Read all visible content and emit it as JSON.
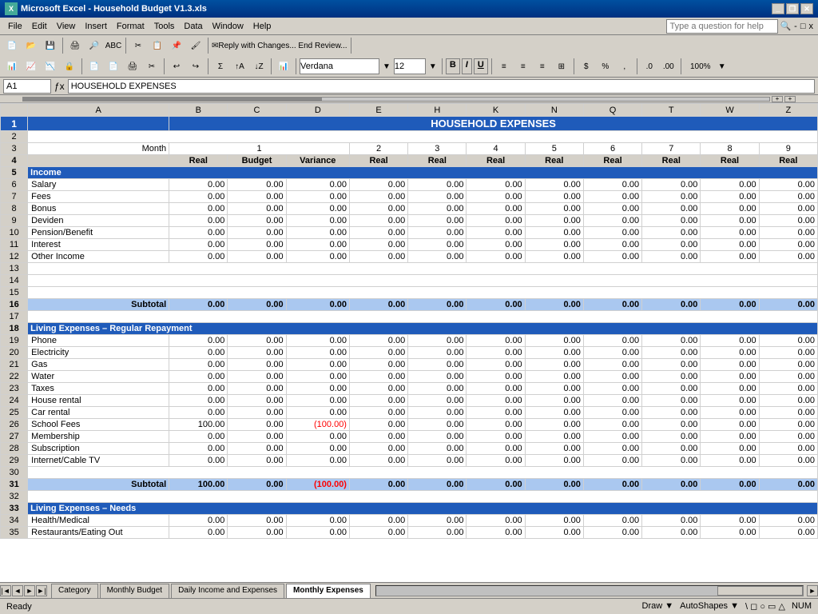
{
  "window": {
    "title": "Microsoft Excel - Household Budget V1.3.xls",
    "icon": "📊"
  },
  "menubar": {
    "items": [
      "File",
      "Edit",
      "View",
      "Insert",
      "Format",
      "Tools",
      "Data",
      "Window",
      "Help"
    ]
  },
  "toolbar": {
    "font": "Verdana",
    "font_size": "12",
    "zoom": "100%",
    "question_placeholder": "Type a question for help"
  },
  "formula_bar": {
    "cell_ref": "A1",
    "formula": "HOUSEHOLD EXPENSES"
  },
  "spreadsheet": {
    "title": "HOUSEHOLD EXPENSES",
    "col_headers": [
      "A",
      "B",
      "C",
      "D",
      "E",
      "H",
      "K",
      "N",
      "Q",
      "T",
      "W",
      "Z"
    ],
    "row_numbers": [
      1,
      2,
      3,
      4,
      5,
      6,
      7,
      8,
      9,
      10,
      11,
      12,
      13,
      14,
      15,
      16,
      17,
      18,
      19,
      20,
      21,
      22,
      23,
      24,
      25,
      26,
      27,
      28,
      29,
      30,
      31,
      32,
      33,
      34,
      35
    ],
    "months": [
      "",
      "1",
      "",
      "",
      "2",
      "3",
      "4",
      "5",
      "6",
      "7",
      "8",
      "9"
    ],
    "sub_headers": [
      "Real",
      "Budget",
      "Variance",
      "Real",
      "Real",
      "Real",
      "Real",
      "Real",
      "Real",
      "Real",
      "Real"
    ],
    "income_items": [
      "Salary",
      "Fees",
      "Bonus",
      "Deviden",
      "Pension/Benefit",
      "Interest",
      "Other Income"
    ],
    "living_regular_items": [
      "Phone",
      "Electricity",
      "Gas",
      "Water",
      "Taxes",
      "House rental",
      "Car rental",
      "School Fees",
      "Membership",
      "Subscription",
      "Internet/Cable TV"
    ],
    "living_needs_items": [
      "Health/Medical",
      "Restaurants/Eating Out"
    ],
    "school_fees_b": "100.00",
    "school_fees_d": "(100.00)"
  },
  "tabs": {
    "items": [
      "Category",
      "Monthly Budget",
      "Daily Income and Expenses",
      "Monthly Expenses"
    ],
    "active": "Monthly Expenses"
  },
  "status": {
    "left": "Ready",
    "right": "NUM"
  }
}
